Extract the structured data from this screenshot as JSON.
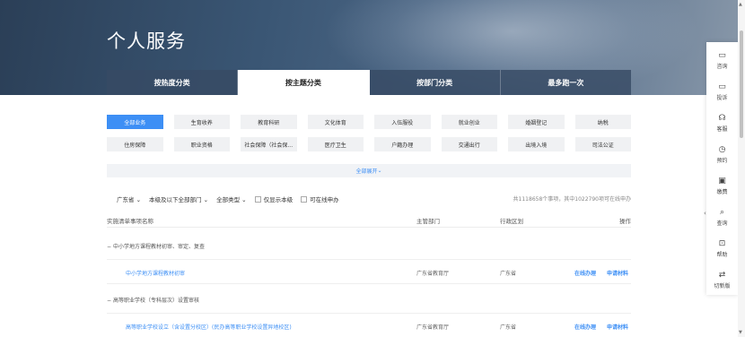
{
  "hero": {
    "title": "个人服务"
  },
  "tabs": [
    {
      "label": "按热度分类",
      "active": false
    },
    {
      "label": "按主题分类",
      "active": true
    },
    {
      "label": "按部门分类",
      "active": false
    },
    {
      "label": "最多跑一次",
      "active": false
    }
  ],
  "categories": [
    {
      "label": "全部业务",
      "active": true
    },
    {
      "label": "生育收养"
    },
    {
      "label": "教育科研"
    },
    {
      "label": "文化体育"
    },
    {
      "label": "入伍服役"
    },
    {
      "label": "就业创业"
    },
    {
      "label": "婚姻登记"
    },
    {
      "label": "纳税"
    },
    {
      "label": "住房保障"
    },
    {
      "label": "职业资格"
    },
    {
      "label": "社会保障（社会保..."
    },
    {
      "label": "医疗卫生"
    },
    {
      "label": "户籍办理"
    },
    {
      "label": "交通出行"
    },
    {
      "label": "出境入境"
    },
    {
      "label": "司法公证"
    }
  ],
  "expand_label": "全部展开",
  "filters": {
    "province": "广东省",
    "level": "本级及以下全部部门",
    "type": "全部类型",
    "only_this_level": "仅显示本级",
    "online_only": "可在线申办"
  },
  "summary": "共1118658个事项，其中1022790项可在线申办",
  "table_header": {
    "name": "实施清单事项名称",
    "dept": "主管部门",
    "region": "行政区划",
    "op": "操作"
  },
  "groups": [
    {
      "title": "中小学地方课程教材初审、审定、复查",
      "rows": [
        {
          "name": "中小学地方课程教材初审",
          "dept": "广东省教育厅",
          "region": "广东省",
          "op1": "在线办理",
          "op2": "申请材料"
        }
      ]
    },
    {
      "title": "高等职业学校（专科层次）设置审核",
      "rows": [
        {
          "name": "高等职业学校设立（含设置分校区）(民办高等职业学校设置异地校区)",
          "dept": "广东省教育厅",
          "region": "广东省",
          "op1": "在线办理",
          "op2": "申请材料"
        }
      ]
    }
  ],
  "sidebar": [
    {
      "icon": "consult-icon",
      "label": "咨询"
    },
    {
      "icon": "complaint-icon",
      "label": "投诉"
    },
    {
      "icon": "service-icon",
      "label": "客服"
    },
    {
      "icon": "booking-icon",
      "label": "预约"
    },
    {
      "icon": "payment-icon",
      "label": "缴费"
    },
    {
      "icon": "query-icon",
      "label": "查询"
    },
    {
      "icon": "help-icon",
      "label": "帮助"
    },
    {
      "icon": "switch-version-icon",
      "label": "切新版"
    }
  ],
  "colors": {
    "accent": "#3d8ff5",
    "hero_dark": "#2b3f57"
  }
}
